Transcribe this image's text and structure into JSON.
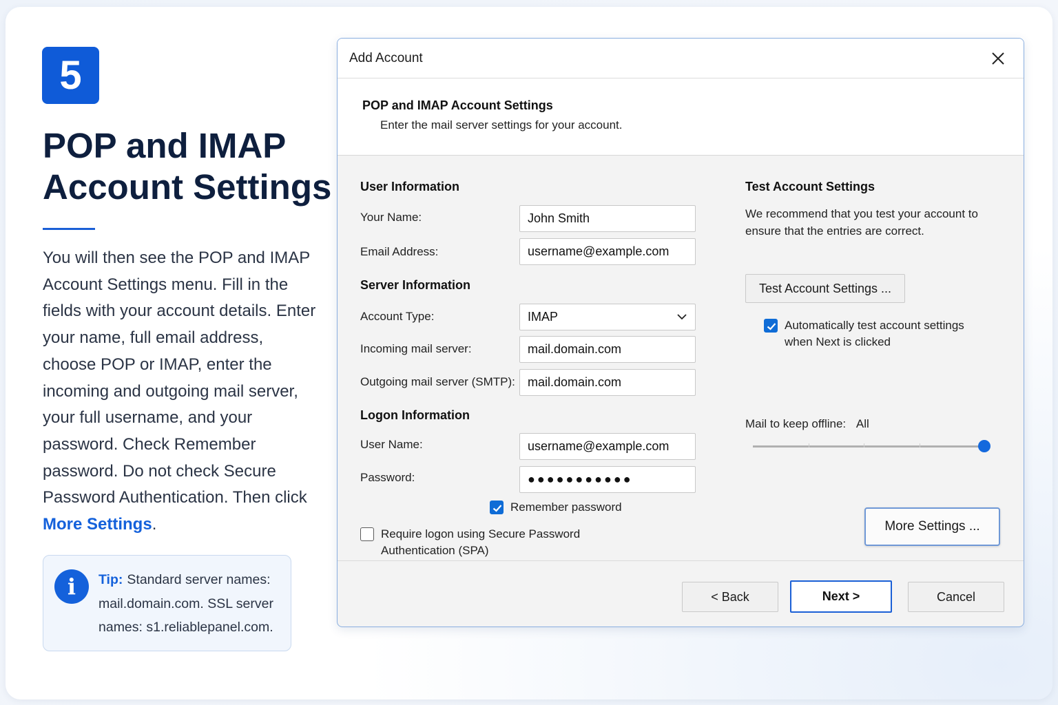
{
  "step": {
    "number": "5",
    "title_line1": "POP and IMAP",
    "title_line2": "Account Settings"
  },
  "instructions": {
    "text": "You will then see the POP and IMAP Account Settings menu. Fill in the fields with your account details. Enter your name, full email address, choose POP or IMAP, enter the incoming and outgoing mail server, your full username, and your password. Check Remember password. Do not check Secure Password Authentication. Then click ",
    "link": "More Settings",
    "end": "."
  },
  "tip": {
    "icon": "info-icon",
    "label": "Tip:",
    "text": "Standard server names: mail.domain.com. SSL server names: s1.reliablepanel.com."
  },
  "dialog": {
    "title": "Add Account",
    "close_icon": "close-icon",
    "header_title": "POP and IMAP Account Settings",
    "header_subtitle": "Enter the mail server settings for your account.",
    "user_info": {
      "title": "User Information",
      "name_label": "Your Name:",
      "name_value": "John Smith",
      "email_label": "Email Address:",
      "email_value": "username@example.com"
    },
    "server_info": {
      "title": "Server Information",
      "account_type_label": "Account Type:",
      "account_type_value": "IMAP",
      "incoming_label": "Incoming mail server:",
      "incoming_value": "mail.domain.com",
      "outgoing_label": "Outgoing mail server (SMTP):",
      "outgoing_value": "mail.domain.com"
    },
    "logon_info": {
      "title": "Logon Information",
      "username_label": "User Name:",
      "username_value": "username@example.com",
      "password_label": "Password:",
      "password_value": "●●●●●●●●●●●",
      "remember_label": "Remember password",
      "remember_checked": true,
      "spa_label_line1": "Require logon using Secure Password",
      "spa_label_line2": "Authentication (SPA)",
      "spa_checked": false
    },
    "test_settings": {
      "title": "Test Account Settings",
      "description": "We recommend that you test your account to ensure that the entries are correct.",
      "button_label": "Test Account Settings ...",
      "auto_test_line1": "Automatically test account settings",
      "auto_test_line2": "when Next is clicked",
      "auto_test_checked": true
    },
    "offline": {
      "label": "Mail to keep offline:",
      "value": "All",
      "slider_fraction": 1.0
    },
    "buttons": {
      "more_settings": "More Settings ...",
      "back": "< Back",
      "next": "Next >",
      "cancel": "Cancel"
    }
  },
  "colors": {
    "accent": "#1461db",
    "title": "#0e1f3e",
    "checkbox": "#0f6cd6"
  }
}
